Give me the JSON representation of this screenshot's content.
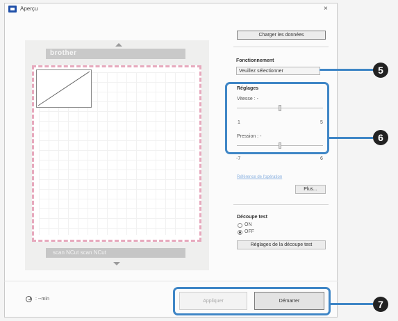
{
  "window": {
    "title": "Aperçu",
    "close_glyph": "×"
  },
  "preview": {
    "brand": "brother",
    "bottom_strip": "scan NCut   scan NCut"
  },
  "right_panel": {
    "load_data_button": "Charger les données",
    "operation_label": "Fonctionnement",
    "operation_select": "Veuillez sélectionner",
    "settings_label": "Réglages",
    "speed_label": "Vitesse : -",
    "speed_min": "1",
    "speed_max": "5",
    "pressure_label": "Pression : -",
    "pressure_min": "-7",
    "pressure_max": "6",
    "help_link": "Référence de l'opération",
    "more_button": "Plus...",
    "test_cut_label": "Découpe test",
    "radio_on": "ON",
    "radio_off": "OFF",
    "test_cut_settings_button": "Réglages de la découpe test"
  },
  "footer": {
    "time_text": ": --min",
    "apply_button": "Appliquer",
    "start_button": "Démarrer"
  },
  "callouts": {
    "five": "5",
    "six": "6",
    "seven": "7"
  },
  "colors": {
    "callout_blue": "#3f86c6",
    "badge": "#222222",
    "mat_border": "#e7a9bd"
  },
  "icons": {
    "timer": "clock-icon",
    "app": "app-icon"
  }
}
